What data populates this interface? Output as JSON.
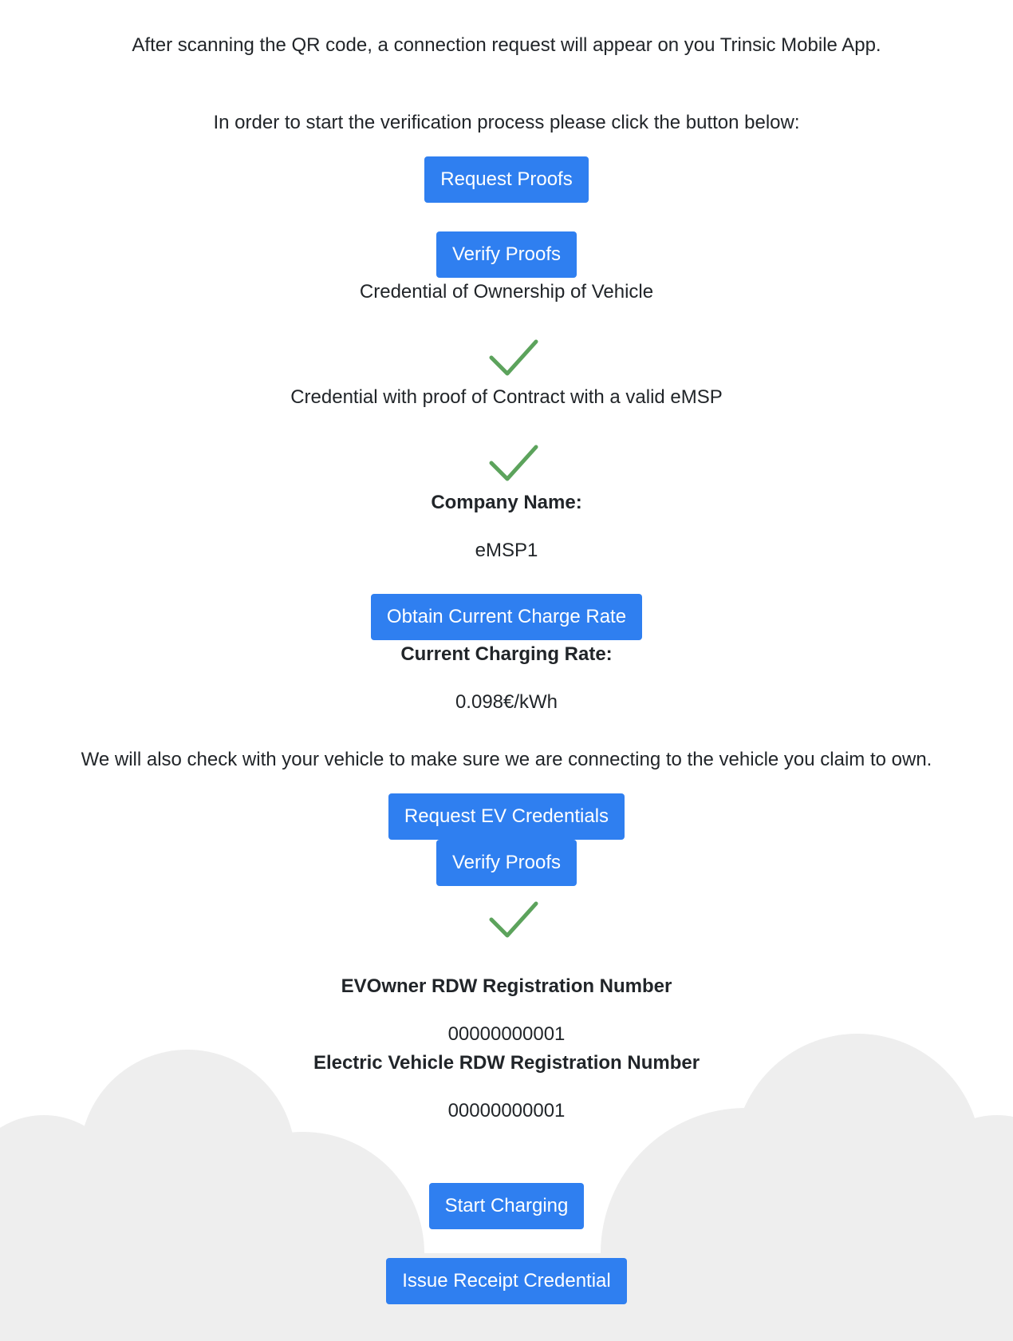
{
  "intro": {
    "qr_text": "After scanning the QR code, a connection request will appear on you Trinsic Mobile App.",
    "start_text": "In order to start the verification process please click the button below:"
  },
  "buttons": {
    "request_proofs": "Request Proofs",
    "verify_proofs_1": "Verify Proofs",
    "obtain_rate": "Obtain Current Charge Rate",
    "request_ev_credentials": "Request EV Credentials",
    "verify_proofs_2": "Verify Proofs",
    "start_charging": "Start Charging",
    "issue_receipt": "Issue Receipt Credential"
  },
  "credentials": {
    "ownership_label": "Credential of Ownership of Vehicle",
    "contract_label": "Credential with proof of Contract with a valid eMSP"
  },
  "company": {
    "label": "Company Name:",
    "value": "eMSP1"
  },
  "rate": {
    "label": "Current Charging Rate:",
    "value": "0.098€/kWh"
  },
  "vehicle_check": {
    "text": "We will also check with your vehicle to make sure we are connecting to the vehicle you claim to own."
  },
  "registration": {
    "owner_label": "EVOwner RDW Registration Number",
    "owner_value": "00000000001",
    "vehicle_label": "Electric Vehicle RDW Registration Number",
    "vehicle_value": "00000000001"
  },
  "colors": {
    "button": "#2f7ff0",
    "check": "#5ca35c",
    "cloud": "#eeeeee",
    "text": "#212529"
  },
  "icons": {
    "check": "check-icon"
  }
}
